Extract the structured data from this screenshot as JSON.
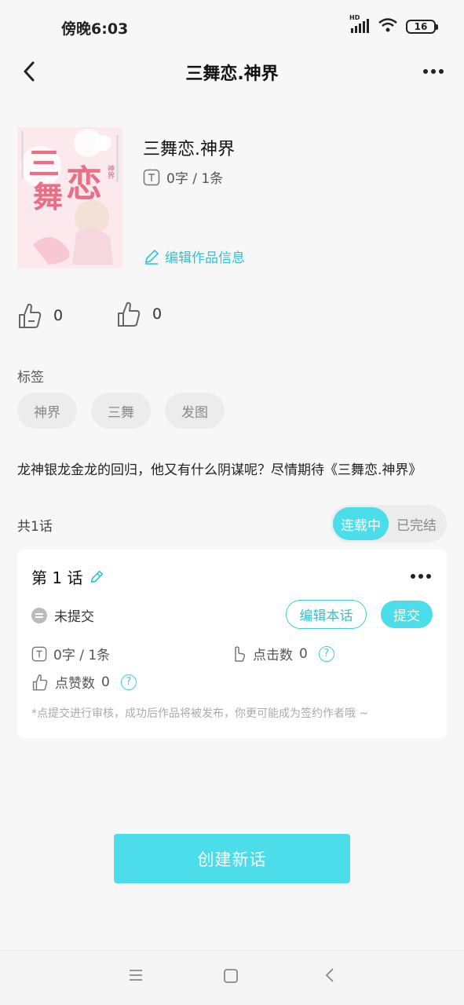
{
  "status_bar": {
    "time": "傍晚6:03",
    "network": "HD",
    "battery": "16"
  },
  "header": {
    "title": "三舞恋.神界"
  },
  "cover": {
    "big_chars": [
      "三",
      "恋",
      "舞"
    ],
    "small_label": "神界"
  },
  "work": {
    "title": "三舞恋.神界",
    "stats": "0字 / 1条",
    "edit_label": "编辑作品信息"
  },
  "likes": {
    "first_count": "0",
    "second_count": "0"
  },
  "tags": {
    "label": "标签",
    "items": [
      "神界",
      "三舞",
      "发图"
    ]
  },
  "description": "龙神银龙金龙的回归，他又有什么阴谋呢？尽情期待《三舞恋.神界》",
  "chapters": {
    "count_label": "共1话",
    "toggle": [
      "连载中",
      "已完结"
    ],
    "items": [
      {
        "title": "第 1 话",
        "status": "未提交",
        "edit_label": "编辑本话",
        "submit_label": "提交",
        "words": "0字 / 1条",
        "clicks_label": "点击数",
        "clicks": "0",
        "likes_label": "点赞数",
        "likes": "0",
        "note": "*点提交进行审核，成功后作品将被发布，你更可能成为签约作者哦 ~"
      }
    ]
  },
  "create_button": "创建新话",
  "colors": {
    "accent": "#4bdde9",
    "accent_text": "#2ec3d6",
    "background": "#f7f7f7"
  }
}
